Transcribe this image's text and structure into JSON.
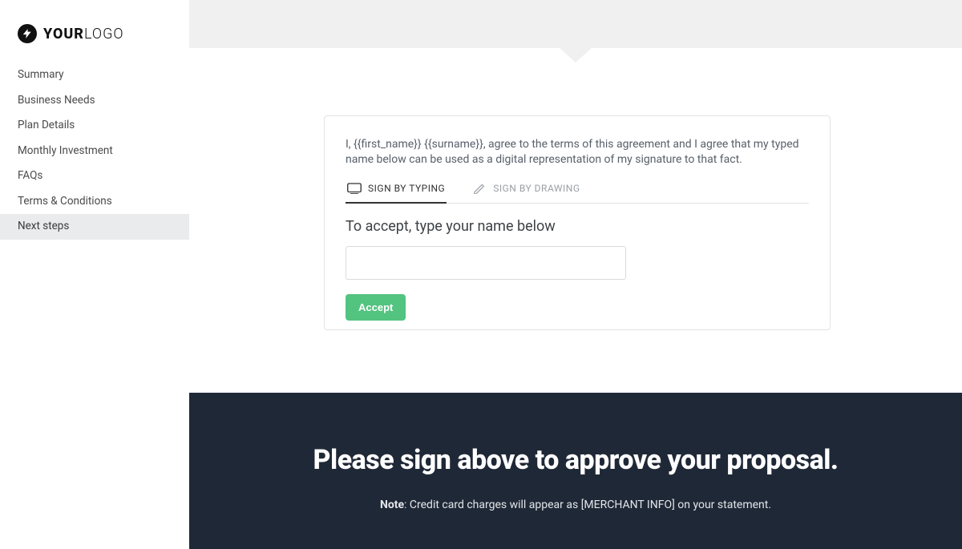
{
  "logo": {
    "bold": "YOUR",
    "light": "LOGO"
  },
  "sidebar": {
    "items": [
      {
        "label": "Summary"
      },
      {
        "label": "Business Needs"
      },
      {
        "label": "Plan Details"
      },
      {
        "label": "Monthly Investment"
      },
      {
        "label": "FAQs"
      },
      {
        "label": "Terms & Conditions"
      },
      {
        "label": "Next steps"
      }
    ],
    "active_index": 6
  },
  "signature": {
    "agreement_text": "I, {{first_name}} {{surname}}, agree to the terms of this agreement and I agree that my typed name below can be used as a digital representation of my signature to that fact.",
    "tabs": {
      "typing": "SIGN BY TYPING",
      "drawing": "SIGN BY DRAWING"
    },
    "prompt": "To accept, type your name below",
    "input_value": "",
    "accept_label": "Accept"
  },
  "footer": {
    "heading": "Please sign above to approve your proposal.",
    "note_bold": "Note",
    "note_rest": ": Credit card charges will appear as [MERCHANT INFO] on your statement."
  }
}
